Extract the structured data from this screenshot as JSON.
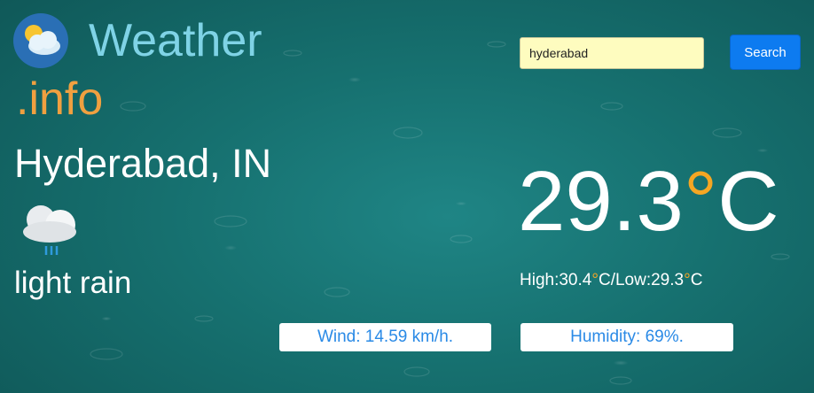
{
  "brand": {
    "word": "Weather",
    "suffix": ".info",
    "icon": "sun-cloud-icon"
  },
  "search": {
    "value": "hyderabad",
    "button_label": "Search"
  },
  "location": {
    "city": "Hyderabad, IN"
  },
  "condition": {
    "description": "light rain",
    "icon": "rain-cloud-icon"
  },
  "temperature": {
    "value": "29.3",
    "unit": "°C",
    "degree_symbol": "°",
    "unit_letter": "C"
  },
  "range": {
    "high_label": "High:",
    "high_value": "30.4",
    "low_label": "/Low:",
    "low_value": "29.3",
    "degree_symbol": "°",
    "unit_letter": "C"
  },
  "details": {
    "wind": "Wind: 14.59 km/h.",
    "humidity": "Humidity: 69%."
  },
  "colors": {
    "accent_orange": "#f5a623",
    "brand_blue": "#7fd3e6",
    "button_blue": "#0d7bf0",
    "pill_text": "#2a8ae6"
  }
}
